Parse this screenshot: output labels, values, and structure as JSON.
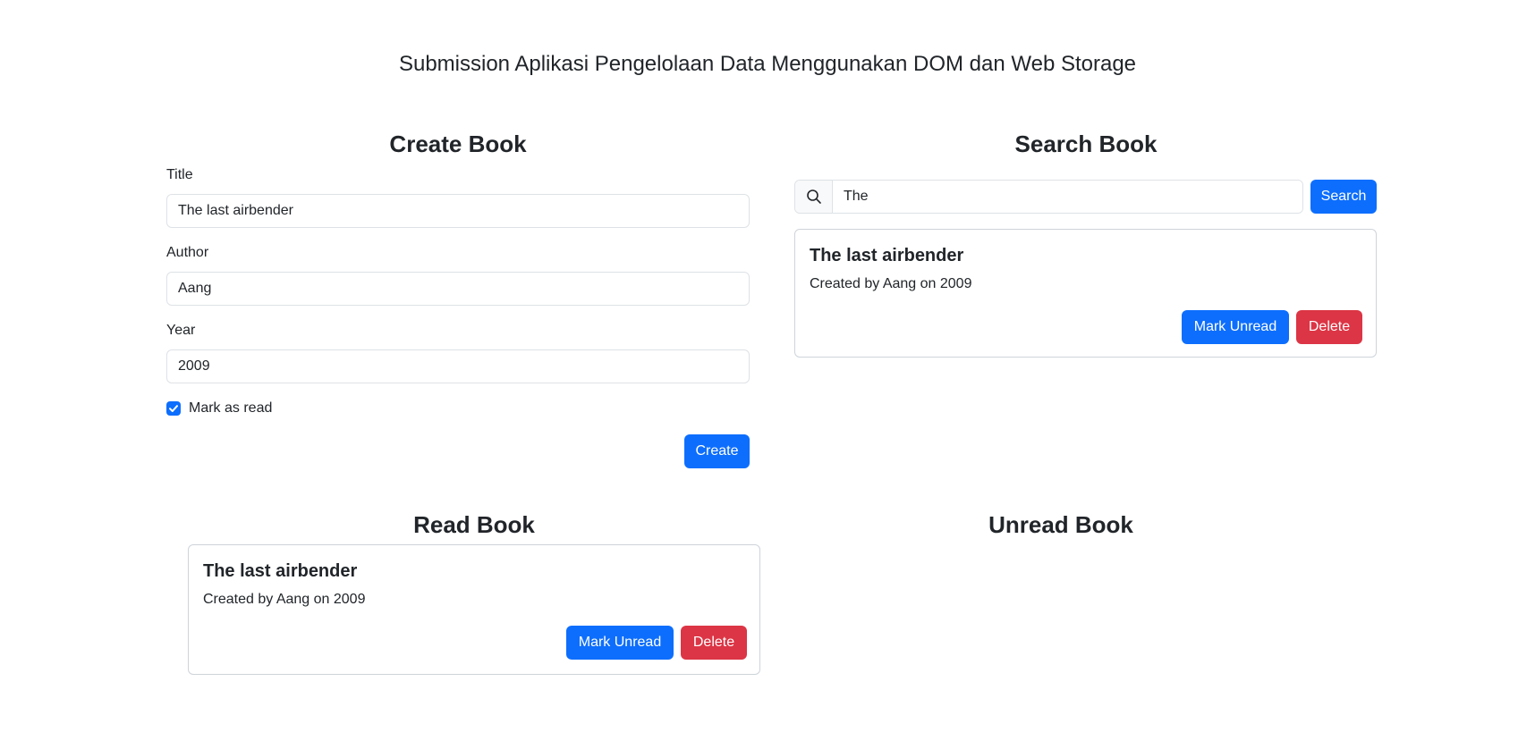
{
  "page": {
    "title": "Submission Aplikasi Pengelolaan Data Menggunakan DOM dan Web Storage"
  },
  "create_book": {
    "heading": "Create Book",
    "title_label": "Title",
    "title_value": "The last airbender",
    "author_label": "Author",
    "author_value": "Aang",
    "year_label": "Year",
    "year_value": "2009",
    "mark_as_read_label": "Mark as read",
    "mark_as_read_checked": true,
    "create_button": "Create"
  },
  "search_book": {
    "heading": "Search Book",
    "query": "The",
    "search_button": "Search",
    "results": [
      {
        "title": "The last airbender",
        "subtitle": "Created by Aang on 2009",
        "toggle_button": "Mark Unread",
        "delete_button": "Delete"
      }
    ]
  },
  "read_book": {
    "heading": "Read Book",
    "books": [
      {
        "title": "The last airbender",
        "subtitle": "Created by Aang on 2009",
        "toggle_button": "Mark Unread",
        "delete_button": "Delete"
      }
    ]
  },
  "unread_book": {
    "heading": "Unread Book",
    "books": []
  },
  "colors": {
    "primary": "#0d6efd",
    "danger": "#dc3545",
    "text": "#212529",
    "border": "#dee2e6"
  },
  "icons": {
    "search": "search-icon",
    "check": "check-icon"
  }
}
